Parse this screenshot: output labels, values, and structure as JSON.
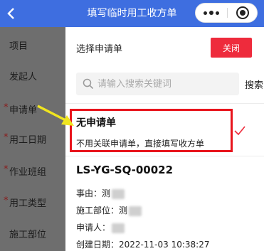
{
  "header": {
    "title": "填写临时用工收方单",
    "back_icon": "chevron-left-icon",
    "more_icon": "more-dots-icon",
    "target_icon": "target-icon"
  },
  "form": {
    "labels": [
      {
        "text": "项目",
        "required": false
      },
      {
        "text": "发起人",
        "required": false
      },
      {
        "text": "申请单",
        "required": true
      },
      {
        "text": "用工日期",
        "required": true
      },
      {
        "text": "作业班组",
        "required": true
      },
      {
        "text": "用工类型",
        "required": true
      },
      {
        "text": "施工部位",
        "required": false
      }
    ]
  },
  "drawer": {
    "title": "选择申请单",
    "close_label": "关闭",
    "search": {
      "placeholder": "请输入搜索关键词",
      "value": "",
      "button_label": "搜索"
    },
    "no_request": {
      "title": "无申请单",
      "description": "不用关联申请单，直接填写收方单",
      "selected": true
    },
    "request": {
      "code": "LS-YG-SQ-00022",
      "reason_label": "事由：",
      "reason_value": "测",
      "location_label": "施工部位：",
      "location_value": "测",
      "applicant_label": "申请人：",
      "applicant_value": "",
      "created_label": "创建日期：",
      "created_value": "2022-11-03 10:38:27"
    }
  },
  "colors": {
    "header_bg": "#3e6ee0",
    "close_button": "#ee2b3c",
    "check": "#ee2b3c",
    "highlight": "#e8141c",
    "arrow": "#f0e51f",
    "overlay": "#6e6e6e"
  }
}
